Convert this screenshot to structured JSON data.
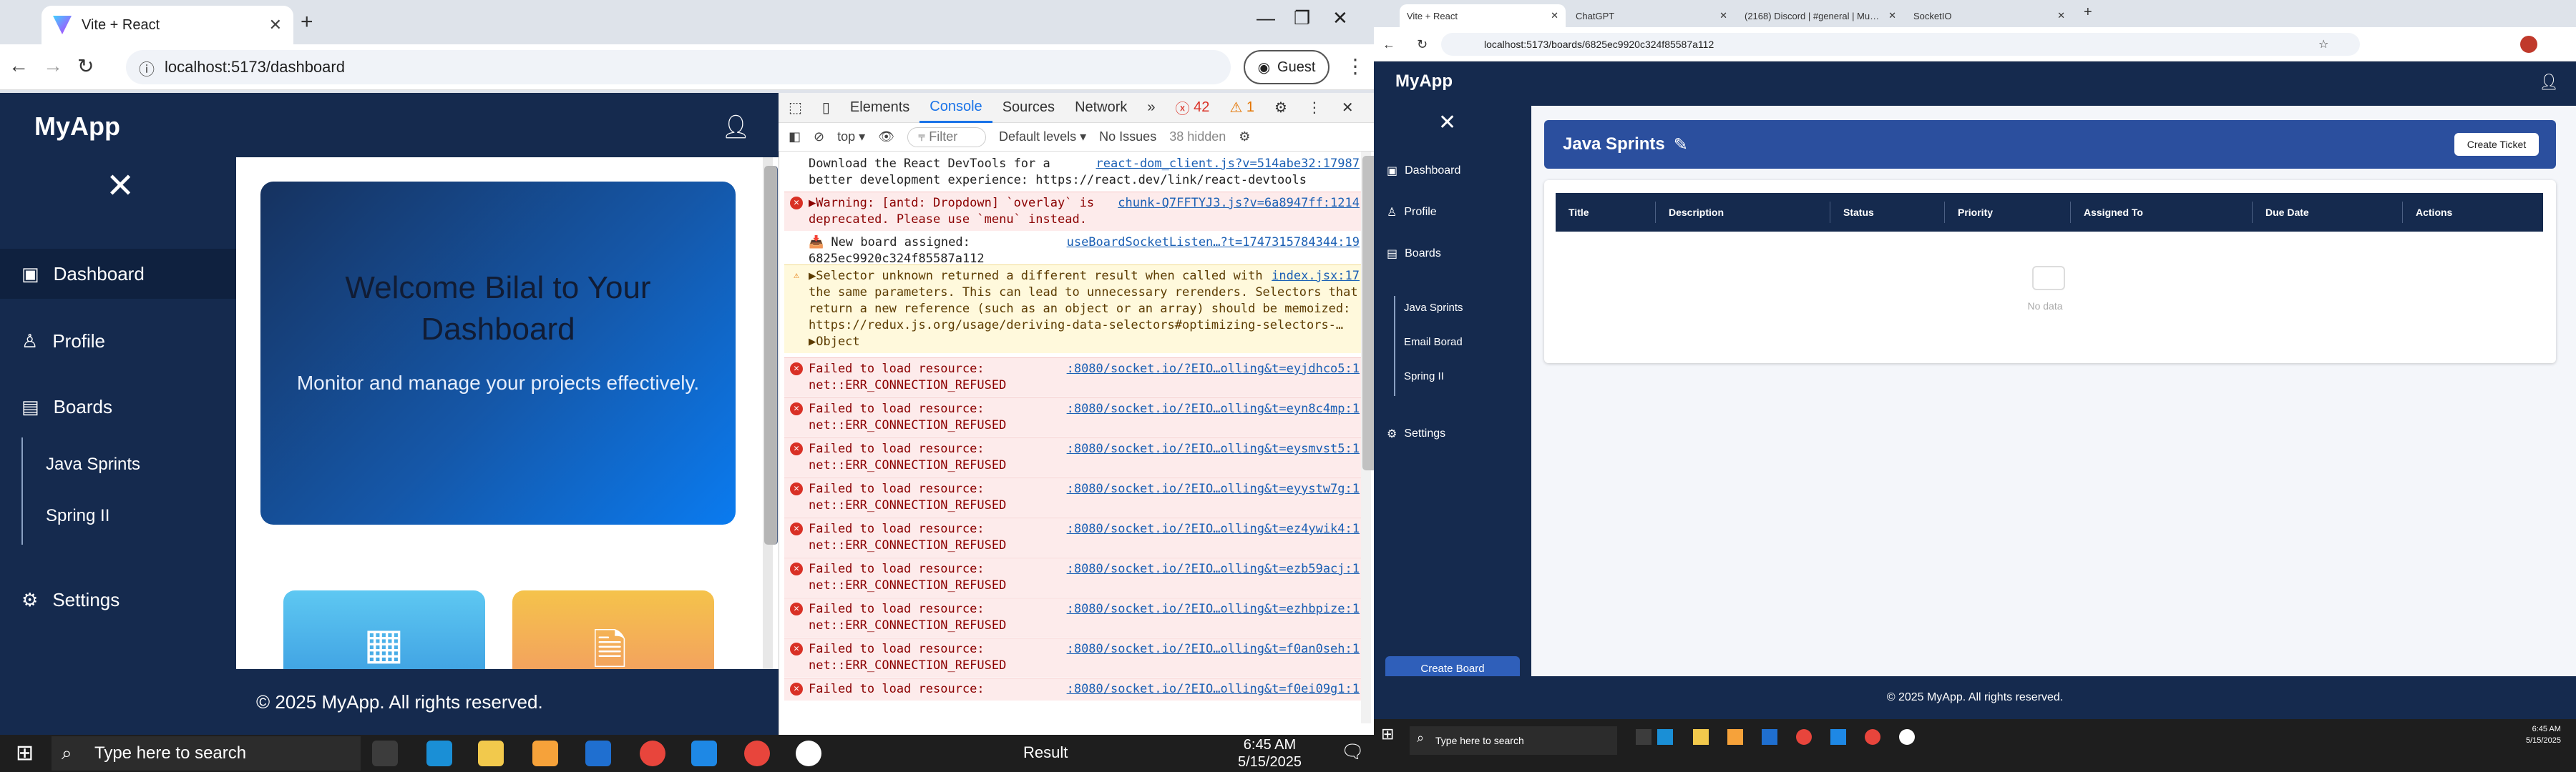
{
  "left": {
    "tab_title": "Vite + React",
    "url": "localhost:5173/dashboard",
    "guest": "Guest",
    "brand": "MyApp",
    "nav": [
      {
        "label": "Dashboard",
        "icon": "dashboard-icon"
      },
      {
        "label": "Profile",
        "icon": "user-icon"
      },
      {
        "label": "Boards",
        "icon": "boards-icon"
      }
    ],
    "boards": [
      "Java Sprints",
      "Spring II"
    ],
    "settings": "Settings",
    "hero_title": "Welcome Bilal to Your Dashboard",
    "hero_sub": "Monitor and manage your projects effectively.",
    "footer": "© 2025 MyApp. All rights reserved.",
    "taskbar_search": "Type here to search",
    "taskbar_result": "Result",
    "time": "6:45 AM",
    "date": "5/15/2025"
  },
  "devtools": {
    "tabs": [
      "Elements",
      "Console",
      "Sources",
      "Network"
    ],
    "errors": "42",
    "warnings": "1",
    "context": "top",
    "filter": "Filter",
    "levels": "Default levels",
    "issues": "No Issues",
    "hidden": "38 hidden",
    "logs": [
      {
        "type": "info",
        "text": "Download the React DevTools for a better development experience: https://react.dev/link/react-devtools",
        "link": "react-dom_client.js?v=514abe32:17987"
      },
      {
        "type": "err",
        "text": "▶Warning: [antd: Dropdown] `overlay` is deprecated. Please use `menu` instead.",
        "link": "chunk-Q7FFTYJ3.js?v=6a8947ff:1214"
      },
      {
        "type": "info",
        "text": "📥 New board assigned: 6825ec9920c324f85587a112",
        "link": "useBoardSocketListen…?t=1747315784344:19"
      },
      {
        "type": "warn",
        "text": "▶Selector unknown returned a different result when called with the same parameters. This can lead to unnecessary rerenders. Selectors that return a new reference (such as an object or an array) should be memoized: https://redux.js.org/usage/deriving-data-selectors#optimizing-selectors-… ▶Object",
        "link": "index.jsx:17"
      },
      {
        "type": "err",
        "text": "Failed to load resource: net::ERR_CONNECTION_REFUSED",
        "link": ":8080/socket.io/?EIO…olling&t=eyjdhco5:1"
      },
      {
        "type": "err",
        "text": "Failed to load resource: net::ERR_CONNECTION_REFUSED",
        "link": ":8080/socket.io/?EIO…olling&t=eyn8c4mp:1"
      },
      {
        "type": "err",
        "text": "Failed to load resource: net::ERR_CONNECTION_REFUSED",
        "link": ":8080/socket.io/?EIO…olling&t=eysmvst5:1"
      },
      {
        "type": "err",
        "text": "Failed to load resource: net::ERR_CONNECTION_REFUSED",
        "link": ":8080/socket.io/?EIO…olling&t=eyystw7g:1"
      },
      {
        "type": "err",
        "text": "Failed to load resource: net::ERR_CONNECTION_REFUSED",
        "link": ":8080/socket.io/?EIO…olling&t=ez4ywik4:1"
      },
      {
        "type": "err",
        "text": "Failed to load resource: net::ERR_CONNECTION_REFUSED",
        "link": ":8080/socket.io/?EIO…olling&t=ezb59acj:1"
      },
      {
        "type": "err",
        "text": "Failed to load resource: net::ERR_CONNECTION_REFUSED",
        "link": ":8080/socket.io/?EIO…olling&t=ezhbpize:1"
      },
      {
        "type": "err",
        "text": "Failed to load resource: net::ERR_CONNECTION_REFUSED",
        "link": ":8080/socket.io/?EIO…olling&t=f0an0seh:1"
      },
      {
        "type": "err",
        "text": "Failed to load resource:",
        "link": ":8080/socket.io/?EIO…olling&t=f0ei09g1:1"
      }
    ]
  },
  "right": {
    "tabs": [
      "Vite + React",
      "ChatGPT",
      "(2168) Discord | #general | Mu…",
      "SocketIO"
    ],
    "url": "localhost:5173/boards/6825ec9920c324f85587a112",
    "brand": "MyApp",
    "nav": [
      "Dashboard",
      "Profile",
      "Boards"
    ],
    "boards": [
      "Java Sprints",
      "Email Borad",
      "Spring II"
    ],
    "settings": "Settings",
    "create_board": "Create Board",
    "board_title": "Java Sprints",
    "create_ticket": "Create Ticket",
    "columns": [
      "Title",
      "Description",
      "Status",
      "Priority",
      "Assigned To",
      "Due Date",
      "Actions"
    ],
    "no_data": "No data",
    "footer": "© 2025 MyApp. All rights reserved.",
    "taskbar_search": "Type here to search",
    "time": "6:45 AM",
    "date": "5/15/2025"
  }
}
